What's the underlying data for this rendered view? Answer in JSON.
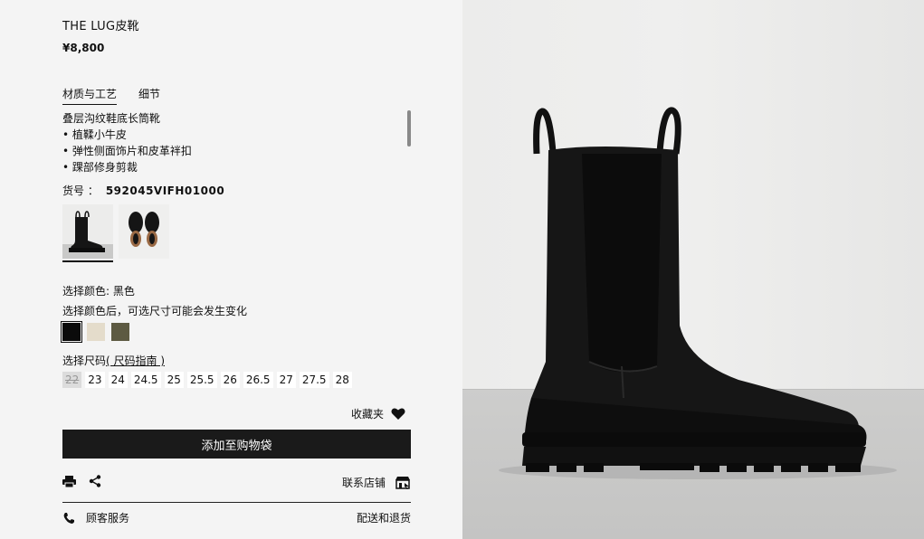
{
  "product": {
    "title": "THE LUG皮靴",
    "price": "¥8,800"
  },
  "tabs": [
    {
      "label": "材质与工艺",
      "active": true
    },
    {
      "label": "细节",
      "active": false
    }
  ],
  "description": {
    "lines": [
      "叠层沟纹鞋底长筒靴",
      "• 植鞣小牛皮",
      "• 弹性侧面饰片和皮革袢扣",
      "• 踝部修身剪裁"
    ]
  },
  "sku": {
    "label": "货号 ：",
    "value": "592045VIFH01000"
  },
  "color": {
    "label": "选择颜色: 黑色",
    "note": "选择颜色后，可选尺寸可能会发生变化",
    "swatches": [
      {
        "name": "black",
        "hex": "#0b0b0b",
        "selected": true
      },
      {
        "name": "cream",
        "hex": "#e4dccb",
        "selected": false
      },
      {
        "name": "olive",
        "hex": "#5d5a42",
        "selected": false
      }
    ]
  },
  "size": {
    "label": "选择尺码",
    "guide": "( 尺码指南 )",
    "options": [
      {
        "value": "22",
        "disabled": true
      },
      {
        "value": "23",
        "disabled": false
      },
      {
        "value": "24",
        "disabled": false
      },
      {
        "value": "24.5",
        "disabled": false
      },
      {
        "value": "25",
        "disabled": false
      },
      {
        "value": "25.5",
        "disabled": false
      },
      {
        "value": "26",
        "disabled": false
      },
      {
        "value": "26.5",
        "disabled": false
      },
      {
        "value": "27",
        "disabled": false
      },
      {
        "value": "27.5",
        "disabled": false
      },
      {
        "value": "28",
        "disabled": false
      }
    ]
  },
  "actions": {
    "favorites": "收藏夹",
    "add_to_bag": "添加至购物袋",
    "contact_store": "联系店铺",
    "customer_service": "顾客服务",
    "delivery_returns": "配送和退货"
  },
  "icons": {
    "favorite": "heart-icon",
    "print": "printer-icon",
    "share": "share-icon",
    "store": "store-icon",
    "phone": "phone-icon"
  },
  "colors": {
    "button_bg": "#1a1a1a",
    "text": "#111111",
    "page_bg": "#f4f4f4"
  }
}
